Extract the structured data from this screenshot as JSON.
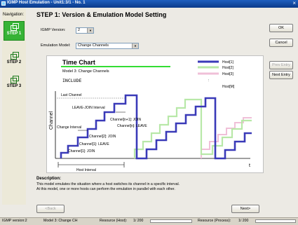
{
  "window": {
    "title": "IGMP Host Emulation - Unit1:3/1 - No. 1",
    "close_glyph": "×"
  },
  "nav": {
    "title": "Navigation:",
    "steps": [
      {
        "label": "STEP 1",
        "active": true
      },
      {
        "label": "STEP 2",
        "active": false
      },
      {
        "label": "STEP 3",
        "active": false
      }
    ]
  },
  "header": "STEP 1: Version & Emulation Model Setting",
  "form": {
    "igmp_version_label": "IGMP Version:",
    "igmp_version_value": "2",
    "emulation_model_label": "Emulation Model:",
    "emulation_model_value": "Change Channels"
  },
  "buttons": {
    "ok": "OK",
    "cancel": "Cancel",
    "prev_entry": "Prev Entry",
    "next_entry": "Next Entry",
    "back": "<Back",
    "next": "Next>"
  },
  "diagram": {
    "title": "Time Chart",
    "subtitle": "Model 3: Change Channels",
    "mode": "INCLUDE",
    "ylabel": "Channel",
    "xlabel": "t",
    "legend": [
      {
        "name": "Host[1]",
        "color": "#3a3ab8"
      },
      {
        "name": "Host[2]",
        "color": "#b8e8a8"
      },
      {
        "name": "Host[3]",
        "color": "#f0c0d8"
      },
      {
        "name": ":",
        "color": ""
      },
      {
        "name": "Host[M]",
        "color": ""
      }
    ],
    "annotations": {
      "last_channel": "Last Channel",
      "leave_join_interval": "LEAVE-JOIN Interval",
      "change_interval": "Change Interval",
      "channel_n1_join": "Channel[n+1]: JOIN",
      "channel_n_leave": "Channel[n]: LEAVE",
      "channel_2_join": "Channel[2]: JOIN",
      "channel_1_leave": "Channel[1]: LEAVE",
      "channel_1_join": "Channel[1]: JOIN",
      "host_interval": "Host Interval"
    }
  },
  "description": {
    "title": "Description:",
    "lines": [
      "This model emulates the situation where a host switches its channel in a specific interval.",
      "At this model, one or more hosts can perform the emulation in parallel with each other."
    ]
  },
  "status": {
    "igmp_version": "IGMP version:2",
    "model": "Model 3: Change CH",
    "resource_host": "Resource (Host):",
    "resource_host_value": "1/ 200",
    "resource_process": "Resource (Process):",
    "resource_process_value": "1/ 200"
  }
}
